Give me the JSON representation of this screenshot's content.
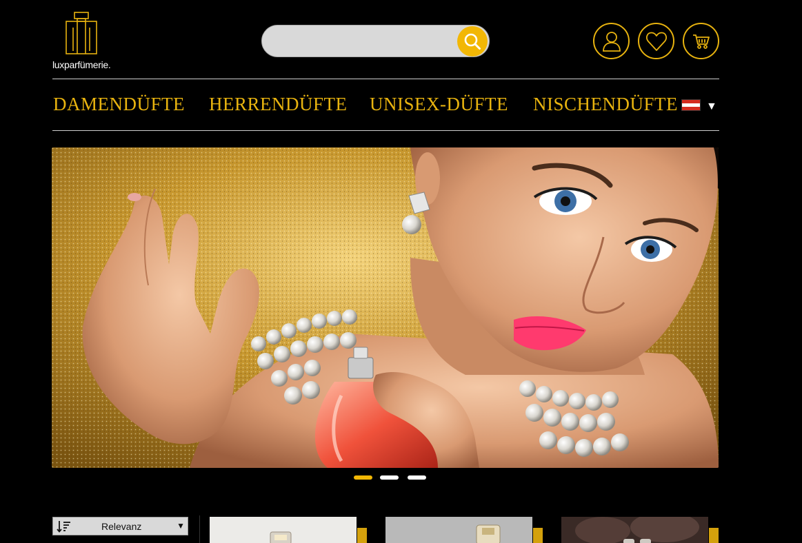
{
  "brand": {
    "name": "luxparfümerie.",
    "logo_icon": "perfume-bottle-logo"
  },
  "search": {
    "placeholder": "",
    "button_icon": "search-icon"
  },
  "header_actions": [
    {
      "icon": "user-icon"
    },
    {
      "icon": "heart-icon"
    },
    {
      "icon": "cart-icon"
    }
  ],
  "nav": {
    "items": [
      {
        "label": "DAMENDÜFTE"
      },
      {
        "label": "HERRENDÜFTE"
      },
      {
        "label": "UNISEX-DÜFTE"
      },
      {
        "label": "NISCHENDÜFTE"
      }
    ],
    "language": {
      "flag": "austria-flag-icon",
      "caret": "▼"
    }
  },
  "hero": {
    "slides_total": 3,
    "active_slide": 1
  },
  "sort": {
    "label": "Relevanz",
    "caret": "▼"
  },
  "colors": {
    "accent": "#f2b705",
    "gold_text": "#e8b30f",
    "background": "#000000",
    "austria_red": "#d52b1e"
  }
}
